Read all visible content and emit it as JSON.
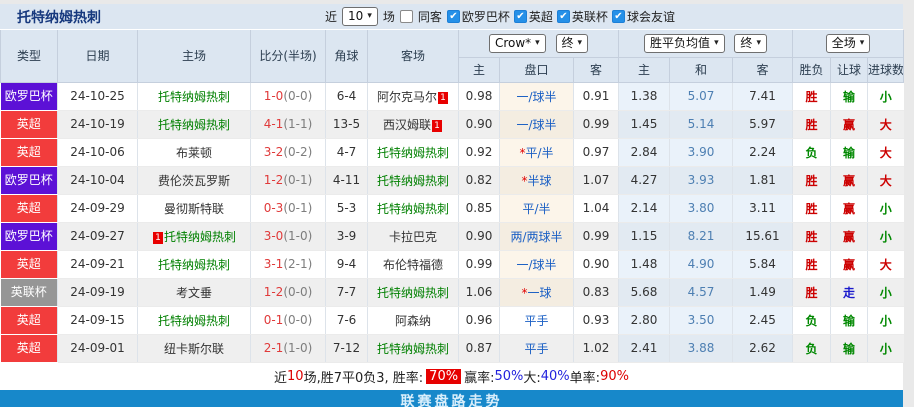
{
  "accent": {
    "europa_purple": "#5c11d6",
    "premier_red": "#f23c3c",
    "league_cup_gray": "#969696",
    "footer_blue": "#1788ca",
    "checkbox_blue": "#2590e8",
    "rate_badge_red": "#e60000"
  },
  "header": {
    "team_title": "托特纳姆热刺",
    "recent_label": "近",
    "recent_count": "10",
    "matches_label": "场",
    "same_venue_label": "同客",
    "filters": [
      "欧罗巴杯",
      "英超",
      "英联杯",
      "球会友谊"
    ]
  },
  "table": {
    "dropdowns": {
      "source": "Crow*",
      "final1": "终",
      "avg": "胜平负均值",
      "final2": "终",
      "fulltime": "全场"
    },
    "columns": [
      "类型",
      "日期",
      "主场",
      "比分(半场)",
      "角球",
      "客场",
      "主",
      "盘口",
      "客",
      "主",
      "和",
      "客",
      "胜负",
      "让球",
      "进球数"
    ],
    "type_colors": {
      "欧罗巴杯": "#5c11d6",
      "英超": "#f23c3c",
      "英联杯": "#969696"
    },
    "rows": [
      {
        "type": "欧罗巴杯",
        "date": "24-10-25",
        "home": "托特纳姆热刺",
        "home_green": true,
        "home_card": "",
        "score": "1-0",
        "half": "(0-0)",
        "corners": "6-4",
        "away": "阿尔克马尔",
        "away_green": false,
        "away_card": "1",
        "home_odds": "0.98",
        "handicap": "一/球半",
        "star": false,
        "away_odds": "0.91",
        "avg_home": "1.38",
        "avg_draw": "5.07",
        "avg_away": "7.41",
        "result": "胜",
        "let_result": "输",
        "goal_result": "小"
      },
      {
        "type": "英超",
        "date": "24-10-19",
        "home": "托特纳姆热刺",
        "home_green": true,
        "home_card": "",
        "score": "4-1",
        "half": "(1-1)",
        "corners": "13-5",
        "away": "西汉姆联",
        "away_green": false,
        "away_card": "1",
        "home_odds": "0.90",
        "handicap": "一/球半",
        "star": false,
        "away_odds": "0.99",
        "avg_home": "1.45",
        "avg_draw": "5.14",
        "avg_away": "5.97",
        "result": "胜",
        "let_result": "赢",
        "goal_result": "大"
      },
      {
        "type": "英超",
        "date": "24-10-06",
        "home": "布莱顿",
        "home_green": false,
        "home_card": "",
        "score": "3-2",
        "half": "(0-2)",
        "corners": "4-7",
        "away": "托特纳姆热刺",
        "away_green": true,
        "away_card": "",
        "home_odds": "0.92",
        "handicap": "平/半",
        "star": true,
        "away_odds": "0.97",
        "avg_home": "2.84",
        "avg_draw": "3.90",
        "avg_away": "2.24",
        "result": "负",
        "let_result": "输",
        "goal_result": "大"
      },
      {
        "type": "欧罗巴杯",
        "date": "24-10-04",
        "home": "费伦茨瓦罗斯",
        "home_green": false,
        "home_card": "",
        "score": "1-2",
        "half": "(0-1)",
        "corners": "4-11",
        "away": "托特纳姆热刺",
        "away_green": true,
        "away_card": "",
        "home_odds": "0.82",
        "handicap": "半球",
        "star": true,
        "away_odds": "1.07",
        "avg_home": "4.27",
        "avg_draw": "3.93",
        "avg_away": "1.81",
        "result": "胜",
        "let_result": "赢",
        "goal_result": "大"
      },
      {
        "type": "英超",
        "date": "24-09-29",
        "home": "曼彻斯特联",
        "home_green": false,
        "home_card": "",
        "score": "0-3",
        "half": "(0-1)",
        "corners": "5-3",
        "away": "托特纳姆热刺",
        "away_green": true,
        "away_card": "",
        "home_odds": "0.85",
        "handicap": "平/半",
        "star": false,
        "away_odds": "1.04",
        "avg_home": "2.14",
        "avg_draw": "3.80",
        "avg_away": "3.11",
        "result": "胜",
        "let_result": "赢",
        "goal_result": "小"
      },
      {
        "type": "欧罗巴杯",
        "date": "24-09-27",
        "home": "托特纳姆热刺",
        "home_green": true,
        "home_card": "1",
        "score": "3-0",
        "half": "(1-0)",
        "corners": "3-9",
        "away": "卡拉巴克",
        "away_green": false,
        "away_card": "",
        "home_odds": "0.90",
        "handicap": "两/两球半",
        "star": false,
        "away_odds": "0.99",
        "avg_home": "1.15",
        "avg_draw": "8.21",
        "avg_away": "15.61",
        "result": "胜",
        "let_result": "赢",
        "goal_result": "小"
      },
      {
        "type": "英超",
        "date": "24-09-21",
        "home": "托特纳姆热刺",
        "home_green": true,
        "home_card": "",
        "score": "3-1",
        "half": "(2-1)",
        "corners": "9-4",
        "away": "布伦特福德",
        "away_green": false,
        "away_card": "",
        "home_odds": "0.99",
        "handicap": "一/球半",
        "star": false,
        "away_odds": "0.90",
        "avg_home": "1.48",
        "avg_draw": "4.90",
        "avg_away": "5.84",
        "result": "胜",
        "let_result": "赢",
        "goal_result": "大"
      },
      {
        "type": "英联杯",
        "date": "24-09-19",
        "home": "考文垂",
        "home_green": false,
        "home_card": "",
        "score": "1-2",
        "half": "(0-0)",
        "corners": "7-7",
        "away": "托特纳姆热刺",
        "away_green": true,
        "away_card": "",
        "home_odds": "1.06",
        "handicap": "一球",
        "star": true,
        "away_odds": "0.83",
        "avg_home": "5.68",
        "avg_draw": "4.57",
        "avg_away": "1.49",
        "result": "胜",
        "let_result": "走",
        "goal_result": "小"
      },
      {
        "type": "英超",
        "date": "24-09-15",
        "home": "托特纳姆热刺",
        "home_green": true,
        "home_card": "",
        "score": "0-1",
        "half": "(0-0)",
        "corners": "7-6",
        "away": "阿森纳",
        "away_green": false,
        "away_card": "",
        "home_odds": "0.96",
        "handicap": "平手",
        "star": false,
        "away_odds": "0.93",
        "avg_home": "2.80",
        "avg_draw": "3.50",
        "avg_away": "2.45",
        "result": "负",
        "let_result": "输",
        "goal_result": "小"
      },
      {
        "type": "英超",
        "date": "24-09-01",
        "home": "纽卡斯尔联",
        "home_green": false,
        "home_card": "",
        "score": "2-1",
        "half": "(1-0)",
        "corners": "7-12",
        "away": "托特纳姆热刺",
        "away_green": true,
        "away_card": "",
        "home_odds": "0.87",
        "handicap": "平手",
        "star": false,
        "away_odds": "1.02",
        "avg_home": "2.41",
        "avg_draw": "3.88",
        "avg_away": "2.62",
        "result": "负",
        "let_result": "输",
        "goal_result": "小"
      }
    ]
  },
  "summary": {
    "parts": [
      {
        "text": "近",
        "style": "plain"
      },
      {
        "text": "10",
        "style": "red"
      },
      {
        "text": "场,胜7平0负3, 胜率:",
        "style": "plain"
      },
      {
        "text": "70%",
        "style": "badge"
      },
      {
        "text": " 赢率:",
        "style": "plain"
      },
      {
        "text": "50%",
        "style": "blue"
      },
      {
        "text": " 大:",
        "style": "plain"
      },
      {
        "text": "40%",
        "style": "blue"
      },
      {
        "text": " 单率:",
        "style": "plain"
      },
      {
        "text": "90%",
        "style": "red"
      }
    ]
  },
  "footer": {
    "title": "联赛盘路走势"
  }
}
